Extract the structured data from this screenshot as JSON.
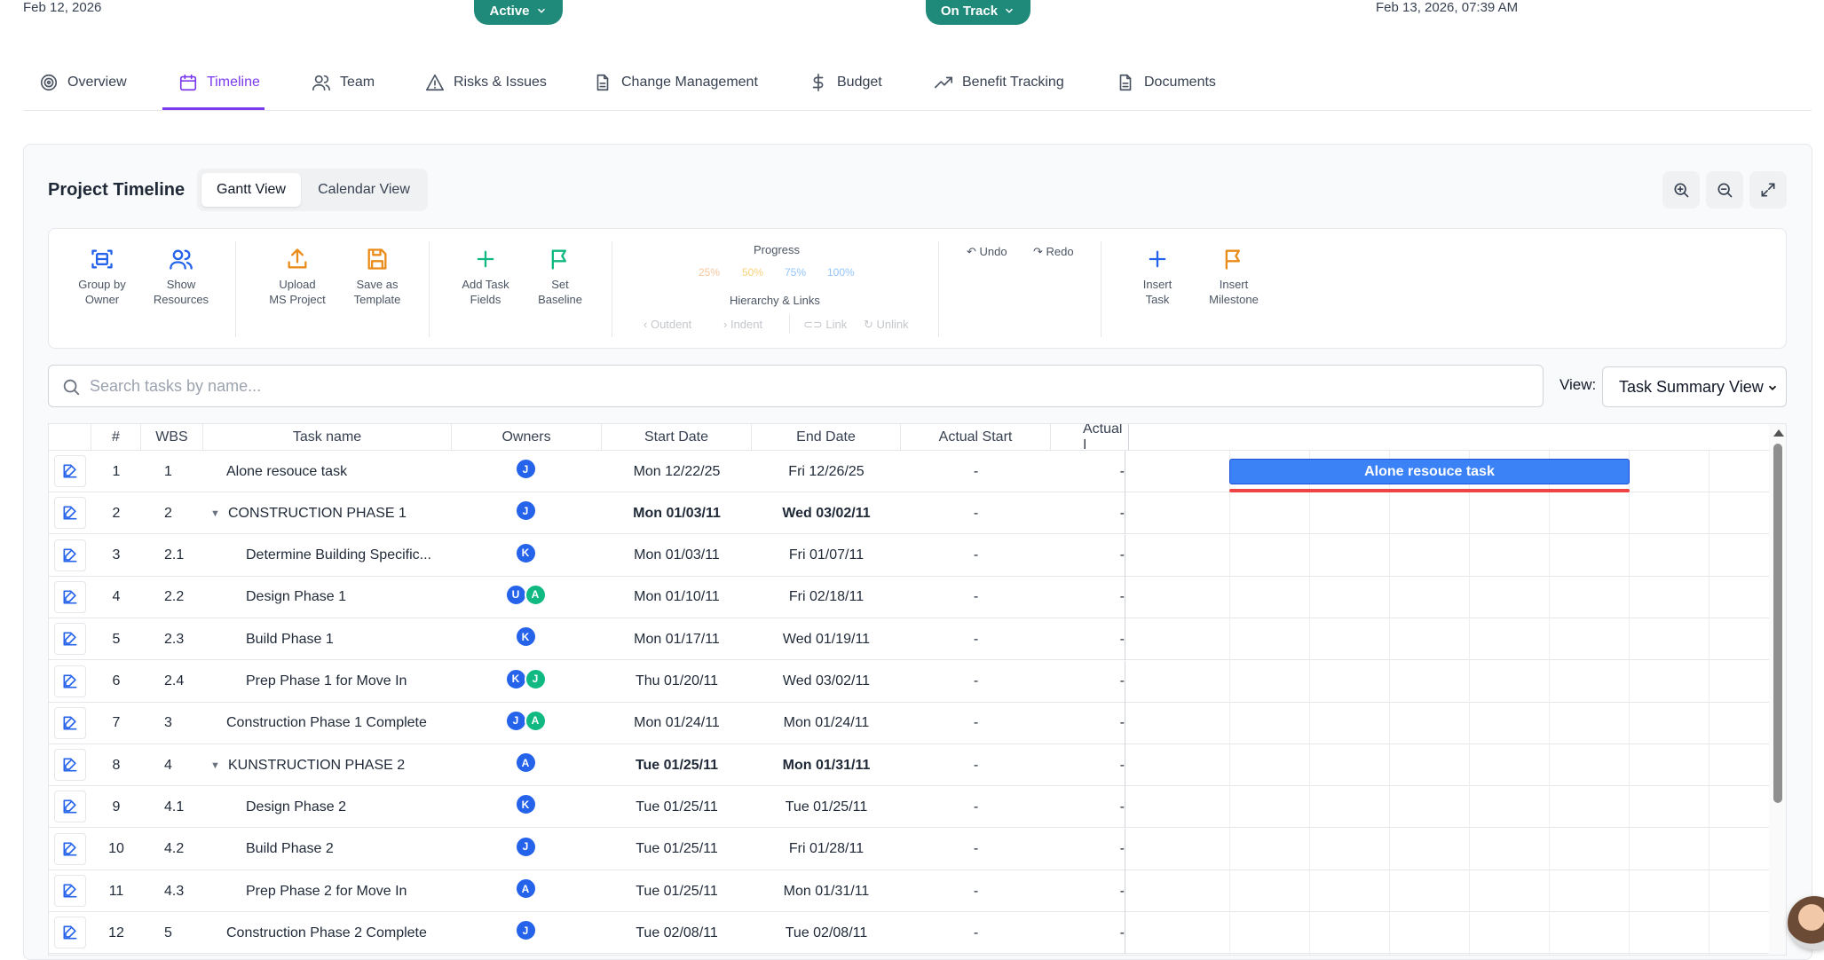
{
  "header": {
    "start_date": "Feb 12, 2026",
    "status_pill": "Active",
    "health_pill": "On Track",
    "updated_at": "Feb 13, 2026, 07:39 AM",
    "status_color": "#1f8a7a",
    "health_color": "#1f8a7a"
  },
  "tabs": [
    {
      "label": "Overview",
      "icon": "target-icon"
    },
    {
      "label": "Timeline",
      "icon": "calendar-icon",
      "active": true
    },
    {
      "label": "Team",
      "icon": "users-icon"
    },
    {
      "label": "Risks & Issues",
      "icon": "warning-icon"
    },
    {
      "label": "Change Management",
      "icon": "document-icon"
    },
    {
      "label": "Budget",
      "icon": "dollar-icon"
    },
    {
      "label": "Benefit Tracking",
      "icon": "trending-up-icon"
    },
    {
      "label": "Documents",
      "icon": "document-icon"
    }
  ],
  "timeline": {
    "title": "Project Timeline",
    "views": [
      "Gantt View",
      "Calendar View"
    ],
    "active_view": "Gantt View"
  },
  "toolbar": {
    "group_by_owner": [
      "Group by",
      "Owner"
    ],
    "show_resources": [
      "Show",
      "Resources"
    ],
    "upload_ms_project": [
      "Upload",
      "MS Project"
    ],
    "save_as_template": [
      "Save as",
      "Template"
    ],
    "add_task_fields": [
      "Add Task",
      "Fields"
    ],
    "set_baseline": [
      "Set",
      "Baseline"
    ],
    "progress_label": "Progress",
    "progress_options": [
      "25%",
      "50%",
      "75%",
      "100%"
    ],
    "hierarchy_label": "Hierarchy & Links",
    "hierarchy_options": [
      "Outdent",
      "Indent",
      "Link",
      "Unlink"
    ],
    "undo": "Undo",
    "redo": "Redo",
    "insert_task": [
      "Insert",
      "Task"
    ],
    "insert_milestone": [
      "Insert",
      "Milestone"
    ],
    "accent_blue": "#2563eb",
    "accent_orange": "#ea8c1a"
  },
  "search": {
    "placeholder": "Search tasks by name..."
  },
  "view_select": {
    "label": "View:",
    "value": "Task Summary View"
  },
  "grid": {
    "columns": [
      "#",
      "WBS",
      "Task name",
      "Owners",
      "Start Date",
      "End Date",
      "Actual Start",
      "Actual I"
    ],
    "rows": [
      {
        "num": "1",
        "wbs": "1",
        "name": "Alone resouce task",
        "owners": [
          "J"
        ],
        "start": "Mon 12/22/25",
        "end": "Fri 12/26/25",
        "actual_start": "-",
        "actual_end": "-",
        "level": 0,
        "summary": false
      },
      {
        "num": "2",
        "wbs": "2",
        "name": "CONSTRUCTION PHASE 1",
        "owners": [
          "J"
        ],
        "start": "Mon 01/03/11",
        "end": "Wed 03/02/11",
        "actual_start": "-",
        "actual_end": "-",
        "level": 0,
        "summary": true
      },
      {
        "num": "3",
        "wbs": "2.1",
        "name": "Determine Building Specific...",
        "owners": [
          "K"
        ],
        "start": "Mon 01/03/11",
        "end": "Fri 01/07/11",
        "actual_start": "-",
        "actual_end": "-",
        "level": 1,
        "summary": false
      },
      {
        "num": "4",
        "wbs": "2.2",
        "name": "Design Phase 1",
        "owners": [
          "U",
          "A"
        ],
        "start": "Mon 01/10/11",
        "end": "Fri 02/18/11",
        "actual_start": "-",
        "actual_end": "-",
        "level": 1,
        "summary": false
      },
      {
        "num": "5",
        "wbs": "2.3",
        "name": "Build Phase 1",
        "owners": [
          "K"
        ],
        "start": "Mon 01/17/11",
        "end": "Wed 01/19/11",
        "actual_start": "-",
        "actual_end": "-",
        "level": 1,
        "summary": false
      },
      {
        "num": "6",
        "wbs": "2.4",
        "name": "Prep Phase 1 for Move In",
        "owners": [
          "K",
          "J"
        ],
        "start": "Thu 01/20/11",
        "end": "Wed 03/02/11",
        "actual_start": "-",
        "actual_end": "-",
        "level": 1,
        "summary": false
      },
      {
        "num": "7",
        "wbs": "3",
        "name": "Construction Phase 1 Complete",
        "owners": [
          "J",
          "A"
        ],
        "start": "Mon 01/24/11",
        "end": "Mon 01/24/11",
        "actual_start": "-",
        "actual_end": "-",
        "level": 0,
        "summary": false
      },
      {
        "num": "8",
        "wbs": "4",
        "name": "KUNSTRUCTION PHASE 2",
        "owners": [
          "A"
        ],
        "start": "Tue 01/25/11",
        "end": "Mon 01/31/11",
        "actual_start": "-",
        "actual_end": "-",
        "level": 0,
        "summary": true
      },
      {
        "num": "9",
        "wbs": "4.1",
        "name": "Design Phase 2",
        "owners": [
          "K"
        ],
        "start": "Tue 01/25/11",
        "end": "Tue 01/25/11",
        "actual_start": "-",
        "actual_end": "-",
        "level": 1,
        "summary": false
      },
      {
        "num": "10",
        "wbs": "4.2",
        "name": "Build Phase 2",
        "owners": [
          "J"
        ],
        "start": "Tue 01/25/11",
        "end": "Fri 01/28/11",
        "actual_start": "-",
        "actual_end": "-",
        "level": 1,
        "summary": false
      },
      {
        "num": "11",
        "wbs": "4.3",
        "name": "Prep Phase 2 for Move In",
        "owners": [
          "A"
        ],
        "start": "Tue 01/25/11",
        "end": "Mon 01/31/11",
        "actual_start": "-",
        "actual_end": "-",
        "level": 1,
        "summary": false
      },
      {
        "num": "12",
        "wbs": "5",
        "name": "Construction Phase 2 Complete",
        "owners": [
          "J"
        ],
        "start": "Tue 02/08/11",
        "end": "Tue 02/08/11",
        "actual_start": "-",
        "actual_end": "-",
        "level": 0,
        "summary": false
      }
    ],
    "avatar_colors": {
      "J": "#2563eb",
      "K": "#2563eb",
      "U": "#2563eb",
      "A": "#10b981"
    },
    "avatar_colors_alt": {
      "A": "#2563eb",
      "J": "#10b981"
    }
  },
  "gantt": {
    "bar_label": "Alone resouce task",
    "bar_color": "#3b82f6",
    "critical_line_color": "#ef4444"
  }
}
